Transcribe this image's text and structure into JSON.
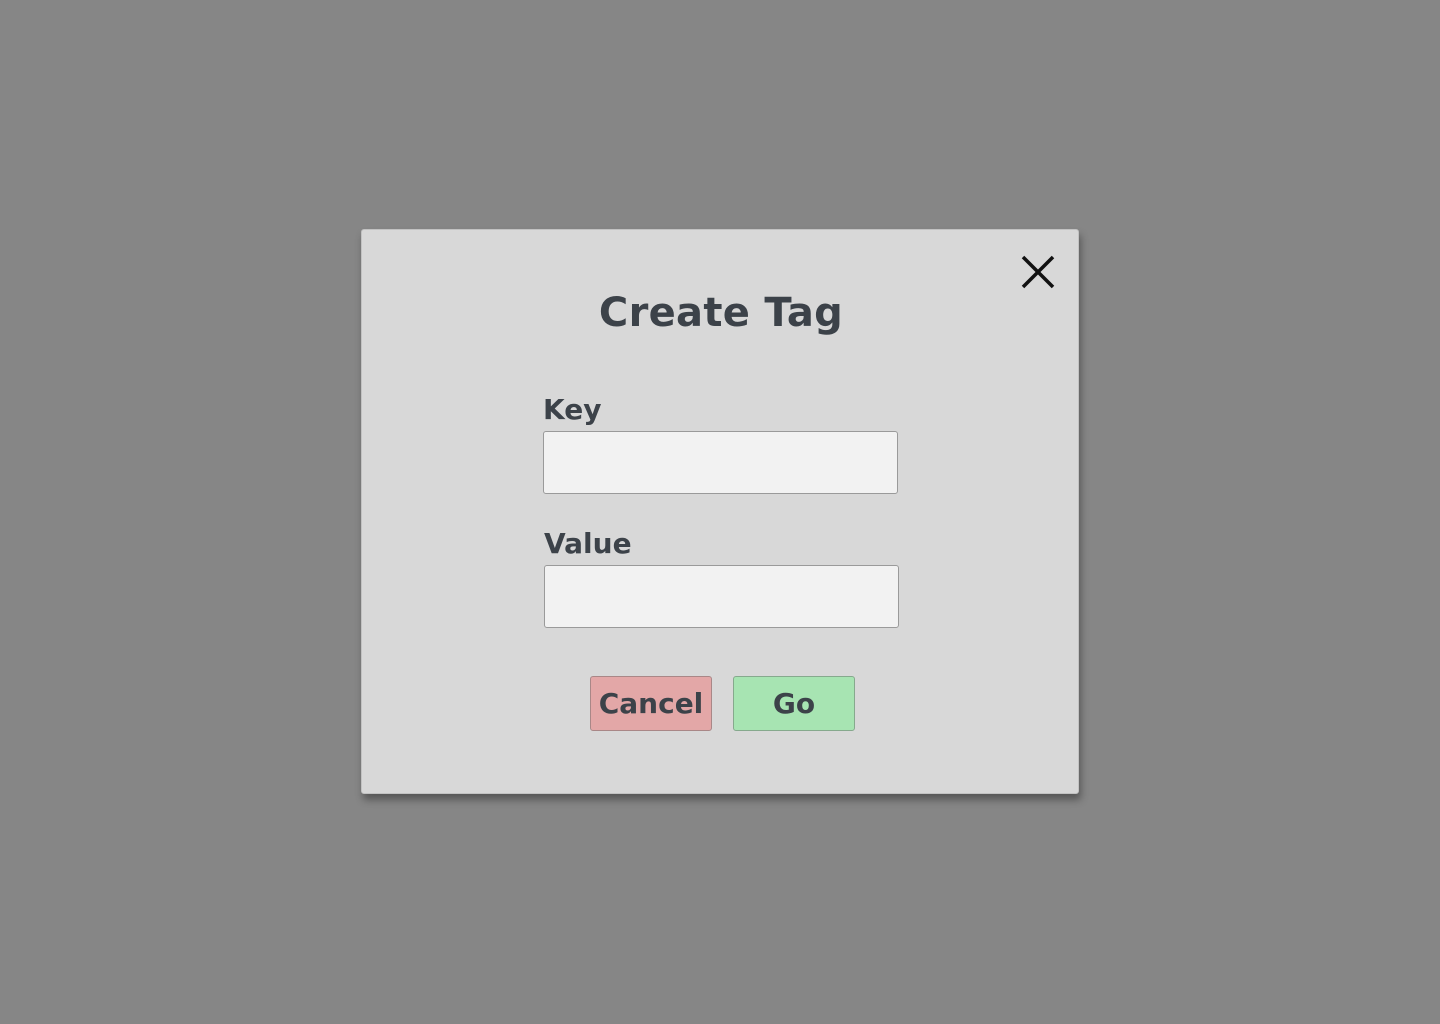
{
  "dialog": {
    "title": "Create Tag",
    "close_icon": "close-icon",
    "fields": {
      "key": {
        "label": "Key",
        "value": "",
        "placeholder": ""
      },
      "value": {
        "label": "Value",
        "value": "",
        "placeholder": ""
      }
    },
    "buttons": {
      "cancel_label": "Cancel",
      "go_label": "Go"
    },
    "colors": {
      "backdrop": "#868686",
      "dialog_bg": "#d8d8d8",
      "text": "#3c4249",
      "cancel_bg": "#e3a7a7",
      "go_bg": "#a7e4b2",
      "input_bg": "#f2f2f2"
    }
  }
}
